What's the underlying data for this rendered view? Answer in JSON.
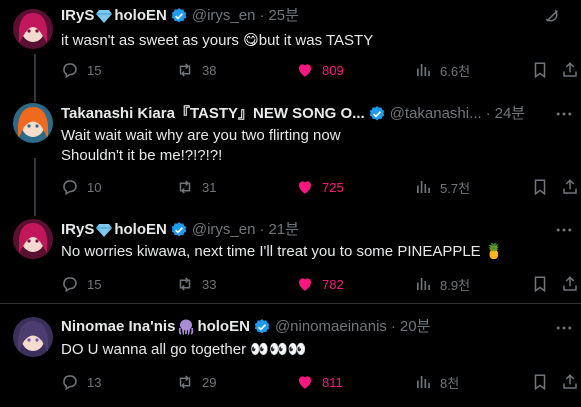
{
  "tweets": [
    {
      "name": "IRyS",
      "name_suffix": "holoEN",
      "handle": "@irys_en",
      "time": "25분",
      "text": "it wasn't as sweet as yours 😋but it was TASTY",
      "replies": "15",
      "retweets": "38",
      "likes": "809",
      "views": "6.6천"
    },
    {
      "name": "Takanashi Kiara『TASTY』NEW SONG O...",
      "name_suffix": "",
      "handle": "@takanashi...",
      "time": "24분",
      "text": "Wait wait wait why are you two flirting now\nShouldn't it be me!?!?!?!",
      "replies": "10",
      "retweets": "31",
      "likes": "725",
      "views": "5.7천"
    },
    {
      "name": "IRyS",
      "name_suffix": "holoEN",
      "handle": "@irys_en",
      "time": "21분",
      "text": "No worries kiwawa, next time I'll treat you to some PINEAPPLE 🍍",
      "replies": "15",
      "retweets": "33",
      "likes": "782",
      "views": "8.9천"
    },
    {
      "name": "Ninomae Ina'nis",
      "name_suffix": "holoEN",
      "handle": "@ninomaeinanis",
      "time": "20분",
      "text": "DO U wanna all go together 👀👀👀",
      "replies": "13",
      "retweets": "29",
      "likes": "811",
      "views": "8천"
    }
  ],
  "colors": {
    "background": "#000000",
    "text": "#e7e9ea",
    "muted": "#71767b",
    "like": "#f91880",
    "verified": "#1d9bf0"
  }
}
